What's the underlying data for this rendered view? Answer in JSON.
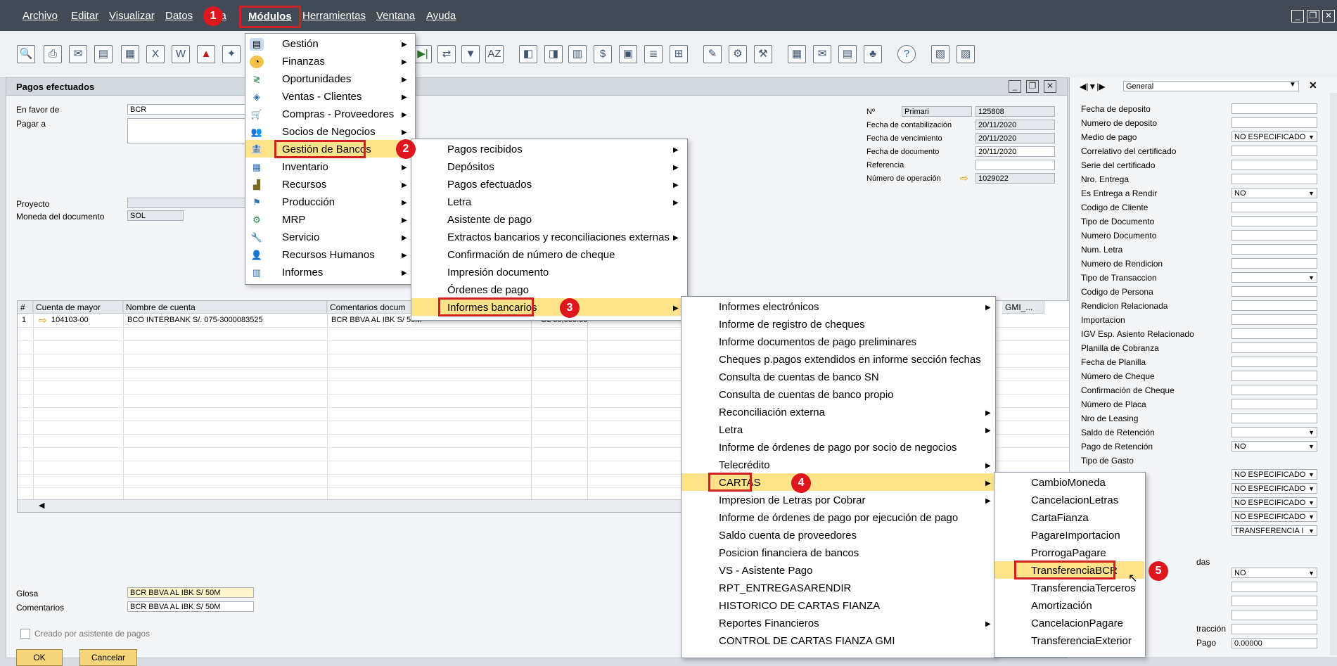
{
  "menubar": {
    "items": [
      "Archivo",
      "Editar",
      "Visualizar",
      "Datos",
      "Ir a",
      "Módulos",
      "Herramientas",
      "Ventana",
      "Ayuda"
    ],
    "window_controls": [
      "_",
      "❐",
      "✕"
    ]
  },
  "toolbar": {
    "icons": [
      "preview-icon",
      "print-icon",
      "email-icon",
      "sms-icon",
      "fax-icon",
      "excel-icon",
      "word-icon",
      "pdf-icon",
      "launch-icon"
    ],
    "icons_right": [
      "first-record-icon",
      "transfer-icon",
      "filter-icon",
      "sort-icon",
      "base-doc-icon",
      "target-doc-icon",
      "copy-icon",
      "gross-profit-icon",
      "volume-icon",
      "journal-icon",
      "relationship-icon",
      "edit-icon",
      "settings-icon",
      "form-settings-icon",
      "calendar-icon",
      "messages-icon",
      "calculator-icon",
      "tree-icon",
      "help-icon",
      "extra1-icon",
      "extra2-icon"
    ]
  },
  "document": {
    "title": "Pagos efectuados",
    "controls": [
      "_",
      "❐",
      "✕"
    ],
    "fields": {
      "en_favor_de_label": "En favor de",
      "en_favor_de_value": "BCR",
      "pagar_a_label": "Pagar a",
      "proyecto_label": "Proyecto",
      "moneda_label": "Moneda del documento",
      "moneda_value": "SOL",
      "no_label": "Nº",
      "no_series": "Primari",
      "no_value": "125808",
      "fecha_contab_label": "Fecha de contabilización",
      "fecha_contab_value": "20/11/2020",
      "fecha_venc_label": "Fecha de vencimiento",
      "fecha_venc_value": "20/11/2020",
      "fecha_doc_label": "Fecha de documento",
      "fecha_doc_value": "20/11/2020",
      "referencia_label": "Referencia",
      "num_operacion_label": "Número de operación",
      "num_operacion_value": "1029022",
      "glosa_label": "Glosa",
      "glosa_value": "BCR BBVA AL IBK S/ 50M",
      "comentarios_label": "Comentarios",
      "comentarios_value": "BCR BBVA AL IBK S/ 50M",
      "asistente_label": "Creado por asistente de pagos"
    },
    "grid": {
      "headers": [
        "#",
        "Cuenta de mayor",
        "Nombre de cuenta",
        "Comentarios docum",
        "GMI_..."
      ],
      "row": {
        "num": "1",
        "cuenta": "104103-00",
        "nombre": "BCO INTERBANK S/. 075-3000083525",
        "comentarios": "BCR BBVA AL IBK S/ 50M",
        "importe": "OL 50,000.00"
      }
    },
    "buttons": {
      "ok": "OK",
      "cancel": "Cancelar"
    }
  },
  "right_panel": {
    "selector": "General",
    "labels": [
      "Fecha de deposito",
      "Numero de deposito",
      "Medio de pago",
      "Correlativo del certificado",
      "Serie del certificado",
      "Nro. Entrega",
      "Es Entrega a Rendir",
      "Codigo de Cliente",
      "Tipo de Documento",
      "Numero Documento",
      "Num. Letra",
      "Numero de Rendicion",
      "Tipo de Transaccion",
      "Codigo de Persona",
      "Rendicion Relacionada",
      "Importacion",
      "IGV Esp. Asiento Relacionado",
      "Planilla de Cobranza",
      "Fecha de Planilla",
      "Número de Cheque",
      "Confirmación de Cheque",
      "Número de Placa",
      "Nro de Leasing",
      "Saldo de Retención",
      "Pago de Retención",
      "Tipo de Gasto"
    ],
    "values": {
      "medio_pago": "NO ESPECIFICADO",
      "entrega_rendir": "NO",
      "pago_retencion": "NO"
    },
    "lower_values": [
      "NO ESPECIFICADO",
      "NO ESPECIFICADO",
      "NO ESPECIFICADO",
      "NO ESPECIFICADO",
      "TRANSFERENCIA I",
      "NO",
      "0.00000"
    ],
    "lower_labels_partial": [
      "das",
      "tracción",
      "Pago"
    ]
  },
  "menu_modulos": {
    "items": [
      "Gestión",
      "Finanzas",
      "Oportunidades",
      "Ventas - Clientes",
      "Compras - Proveedores",
      "Socios de Negocios",
      "Gestión de Bancos",
      "Inventario",
      "Recursos",
      "Producción",
      "MRP",
      "Servicio",
      "Recursos Humanos",
      "Informes"
    ],
    "icons": [
      "gestion-icon",
      "finanzas-icon",
      "oportunidades-icon",
      "ventas-icon",
      "compras-icon",
      "socios-icon",
      "bancos-icon",
      "inventario-icon",
      "recursos-icon",
      "produccion-icon",
      "mrp-icon",
      "servicio-icon",
      "rrhh-icon",
      "informes-icon"
    ]
  },
  "menu_bancos": {
    "items": [
      "Pagos recibidos",
      "Depósitos",
      "Pagos efectuados",
      "Letra",
      "Asistente de pago",
      "Extractos bancarios y reconciliaciones externas",
      "Confirmación de número de cheque",
      "Impresión documento",
      "Órdenes de pago",
      "Informes bancarios"
    ]
  },
  "menu_informes": {
    "items": [
      "Informes electrónicos",
      "Informe de registro de cheques",
      "Informe documentos de pago preliminares",
      "Cheques p.pagos extendidos en informe sección fechas",
      "Consulta de cuentas de banco SN",
      "Consulta de cuentas de banco propio",
      "Reconciliación externa",
      "Letra",
      "Informe de órdenes de pago por socio de negocios",
      "Telecrédito",
      "CARTAS",
      "Impresion de Letras por Cobrar",
      "Informe de órdenes de pago por ejecución de pago",
      "Saldo cuenta de proveedores",
      "Posicion financiera de bancos",
      "VS - Asistente Pago",
      "RPT_ENTREGASARENDIR",
      "HISTORICO DE CARTAS FIANZA",
      "Reportes Financieros",
      "CONTROL DE CARTAS FIANZA GMI"
    ]
  },
  "menu_cartas": {
    "items": [
      "CambioMoneda",
      "CancelacionLetras",
      "CartaFianza",
      "PagareImportacion",
      "ProrrogaPagare",
      "TransferenciaBCR",
      "TransferenciaTerceros",
      "Amortización",
      "CancelacionPagare",
      "TransferenciaExterior"
    ]
  },
  "badges": [
    "1",
    "2",
    "3",
    "4",
    "5"
  ],
  "colors": {
    "menubar": "#424a55",
    "highlight": "#ffe38a",
    "annotation": "#d12020"
  }
}
